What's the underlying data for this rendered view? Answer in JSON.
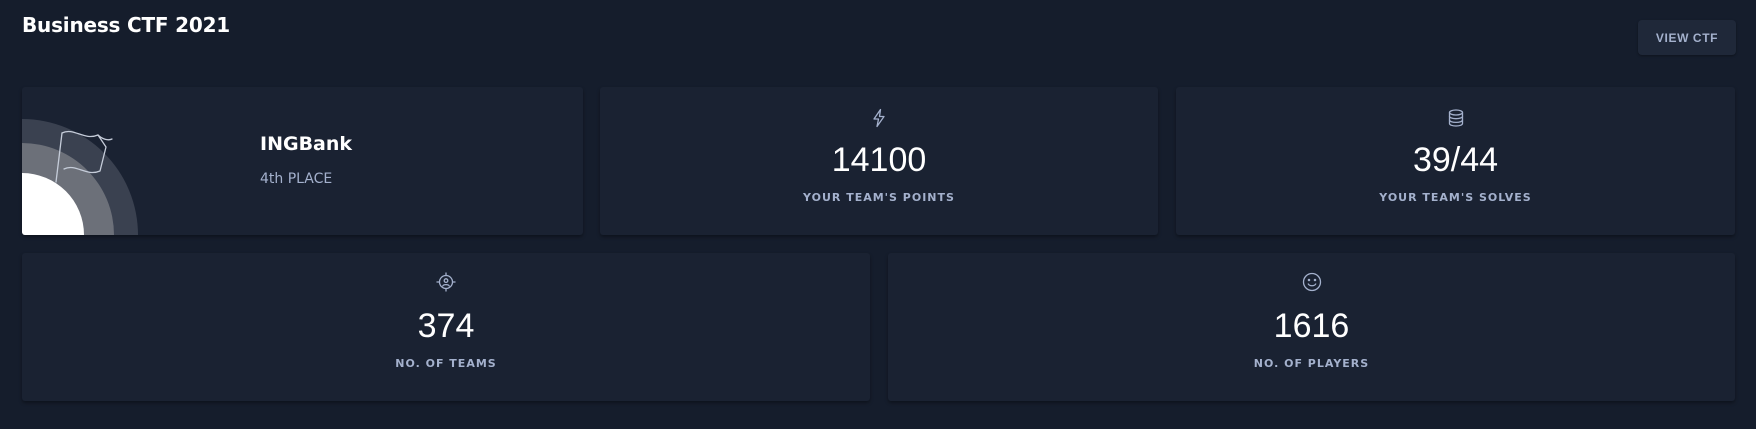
{
  "header": {
    "title": "Business CTF 2021",
    "view_button_label": "VIEW CTF"
  },
  "team": {
    "name": "INGBank",
    "place": "4th PLACE",
    "icon": "flag-icon"
  },
  "stats": {
    "points": {
      "value": "14100",
      "label": "YOUR TEAM'S POINTS",
      "icon": "lightning-icon"
    },
    "solves": {
      "value": "39/44",
      "label": "YOUR TEAM'S SOLVES",
      "icon": "database-icon"
    },
    "teams": {
      "value": "374",
      "label": "NO. OF TEAMS",
      "icon": "target-user-icon"
    },
    "players": {
      "value": "1616",
      "label": "NO. OF PLAYERS",
      "icon": "smiley-icon"
    }
  },
  "colors": {
    "background": "#151d2c",
    "card": "#1a2232",
    "muted_text": "#a4b1cd",
    "button": "#1f2839"
  }
}
